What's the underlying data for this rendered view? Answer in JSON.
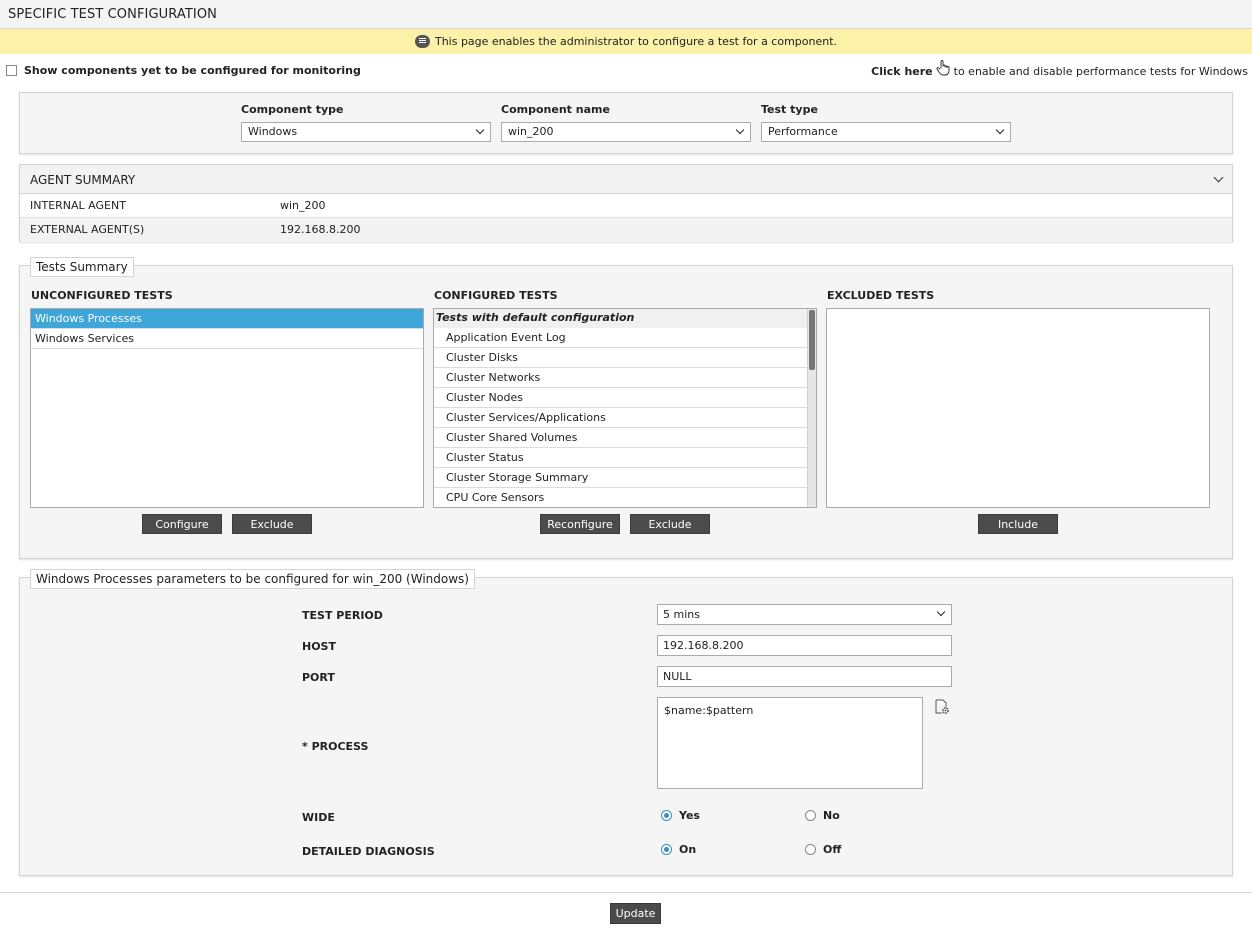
{
  "header": {
    "title": "SPECIFIC TEST CONFIGURATION"
  },
  "info_bar": {
    "message": "This page enables the administrator to configure a test for a component."
  },
  "show_components": {
    "label": "Show components yet to be configured for monitoring",
    "checked": false
  },
  "click_here": {
    "link": "Click here",
    "text": "to enable and disable performance tests for Windows"
  },
  "selectors": {
    "component_type": {
      "label": "Component type",
      "value": "Windows"
    },
    "component_name": {
      "label": "Component name",
      "value": "win_200"
    },
    "test_type": {
      "label": "Test type",
      "value": "Performance"
    }
  },
  "agent_summary": {
    "title": "AGENT SUMMARY",
    "rows": [
      {
        "key": "INTERNAL AGENT",
        "value": "win_200"
      },
      {
        "key": "EXTERNAL AGENT(S)",
        "value": "192.168.8.200"
      }
    ]
  },
  "tests_summary": {
    "title": "Tests Summary",
    "unconfigured": {
      "title": "UNCONFIGURED TESTS",
      "items": [
        "Windows Processes",
        "Windows Services"
      ],
      "selected": "Windows Processes",
      "buttons": {
        "configure": "Configure",
        "exclude": "Exclude"
      }
    },
    "configured": {
      "title": "CONFIGURED TESTS",
      "group": "Tests with default configuration",
      "items": [
        "Application Event Log",
        "Cluster Disks",
        "Cluster Networks",
        "Cluster Nodes",
        "Cluster Services/Applications",
        "Cluster Shared Volumes",
        "Cluster Status",
        "Cluster Storage Summary",
        "CPU Core Sensors"
      ],
      "buttons": {
        "reconfigure": "Reconfigure",
        "exclude": "Exclude"
      }
    },
    "excluded": {
      "title": "EXCLUDED TESTS",
      "items": [],
      "buttons": {
        "include": "Include"
      }
    }
  },
  "params": {
    "title": "Windows Processes parameters to be configured for win_200 (Windows)",
    "test_period": {
      "label": "TEST PERIOD",
      "value": "5 mins"
    },
    "host": {
      "label": "HOST",
      "value": "192.168.8.200"
    },
    "port": {
      "label": "PORT",
      "value": "NULL"
    },
    "process": {
      "label": "* PROCESS",
      "value": "$name:$pattern"
    },
    "wide": {
      "label": "WIDE",
      "options": [
        "Yes",
        "No"
      ],
      "selected": "Yes"
    },
    "detailed_diagnosis": {
      "label": "DETAILED DIAGNOSIS",
      "options": [
        "On",
        "Off"
      ],
      "selected": "On"
    }
  },
  "footer": {
    "update": "Update"
  },
  "colors": {
    "info_bar": "#fbf1a9",
    "selection": "#3ea6d8",
    "button": "#4b4b4b",
    "radio_on": "#3a8fc2"
  }
}
